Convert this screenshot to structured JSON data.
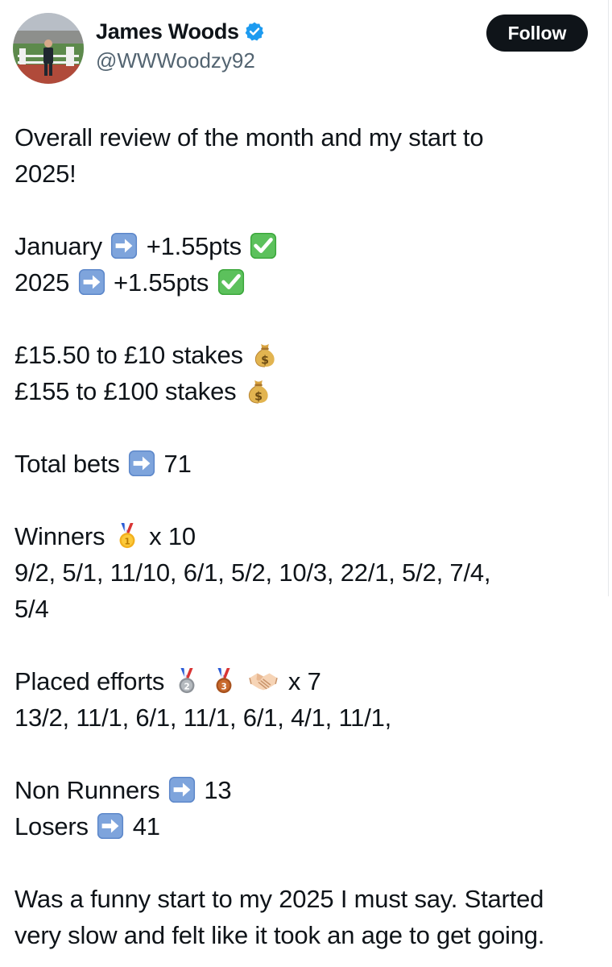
{
  "user": {
    "display_name": "James Woods",
    "handle": "@WWWoodzy92"
  },
  "follow_label": "Follow",
  "tweet": {
    "intro_1": "Overall review of the month and my start to",
    "intro_2": "2025!",
    "january_label": "January",
    "january_value": "+1.55pts",
    "year_label": "2025",
    "year_value": "+1.55pts",
    "stake_10": "£15.50 to £10 stakes",
    "stake_100": "£155 to £100 stakes",
    "total_bets_label": "Total bets",
    "total_bets_value": "71",
    "winners_label": "Winners",
    "winners_count": "x 10",
    "winners_odds_1": "9/2, 5/1, 11/10, 6/1, 5/2, 10/3, 22/1, 5/2, 7/4,",
    "winners_odds_2": "5/4",
    "placed_label": "Placed efforts",
    "placed_count": "x 7",
    "placed_odds": "13/2, 11/1, 6/1, 11/1, 6/1, 4/1, 11/1,",
    "non_runners_label": "Non Runners",
    "non_runners_value": "13",
    "losers_label": "Losers",
    "losers_value": "41",
    "closing_1": "Was a funny start to my 2025 I must say. Started",
    "closing_2": "very slow and felt like it took an age to get going."
  },
  "icons": {
    "arrow": "right-arrow-emoji",
    "check": "check-mark-emoji",
    "money": "money-bag-emoji",
    "gold": "gold-medal-emoji",
    "silver": "silver-medal-emoji",
    "bronze": "bronze-medal-emoji",
    "handshake": "handshake-emoji"
  },
  "colors": {
    "verified": "#1d9bf0",
    "text": "#0f1419",
    "secondary": "#536471",
    "button_bg": "#0f1419"
  }
}
